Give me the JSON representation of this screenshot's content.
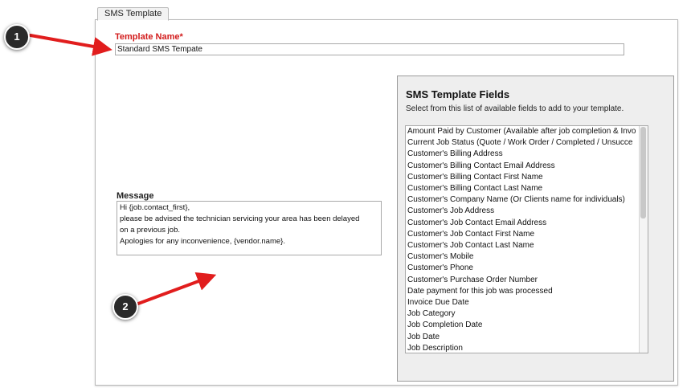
{
  "tab": {
    "label": "SMS Template"
  },
  "template_name": {
    "label": "Template Name*",
    "value": "Standard SMS Tempate"
  },
  "message": {
    "label": "Message",
    "lines": [
      "Hi {job.contact_first},",
      "please be advised the technician servicing your area has been delayed",
      "on a previous job.",
      "Apologies for any inconvenience, {vendor.name}."
    ]
  },
  "fields_panel": {
    "title": "SMS Template Fields",
    "subtitle": "Select from this list of available fields to add to your template.",
    "items": [
      "Amount Paid by Customer (Available after job completion & Invo",
      "Current Job Status (Quote / Work Order / Completed / Unsucce",
      "Customer's Billing Address",
      "Customer's Billing Contact Email Address",
      "Customer's Billing Contact First Name",
      "Customer's Billing Contact Last Name",
      "Customer's Company Name (Or Clients name for individuals)",
      "Customer's Job Address",
      "Customer's Job Contact Email Address",
      "Customer's Job Contact First Name",
      "Customer's Job Contact Last Name",
      "Customer's Mobile",
      "Customer's Phone",
      "Customer's Purchase Order Number",
      "Date payment for this job was processed",
      "Invoice Due Date",
      "Job Category",
      "Job Completion Date",
      "Job Date",
      "Job Description"
    ]
  },
  "markers": {
    "one": "1",
    "two": "2"
  },
  "colors": {
    "label_red": "#d21b1b",
    "arrow_red": "#e11d1d"
  }
}
